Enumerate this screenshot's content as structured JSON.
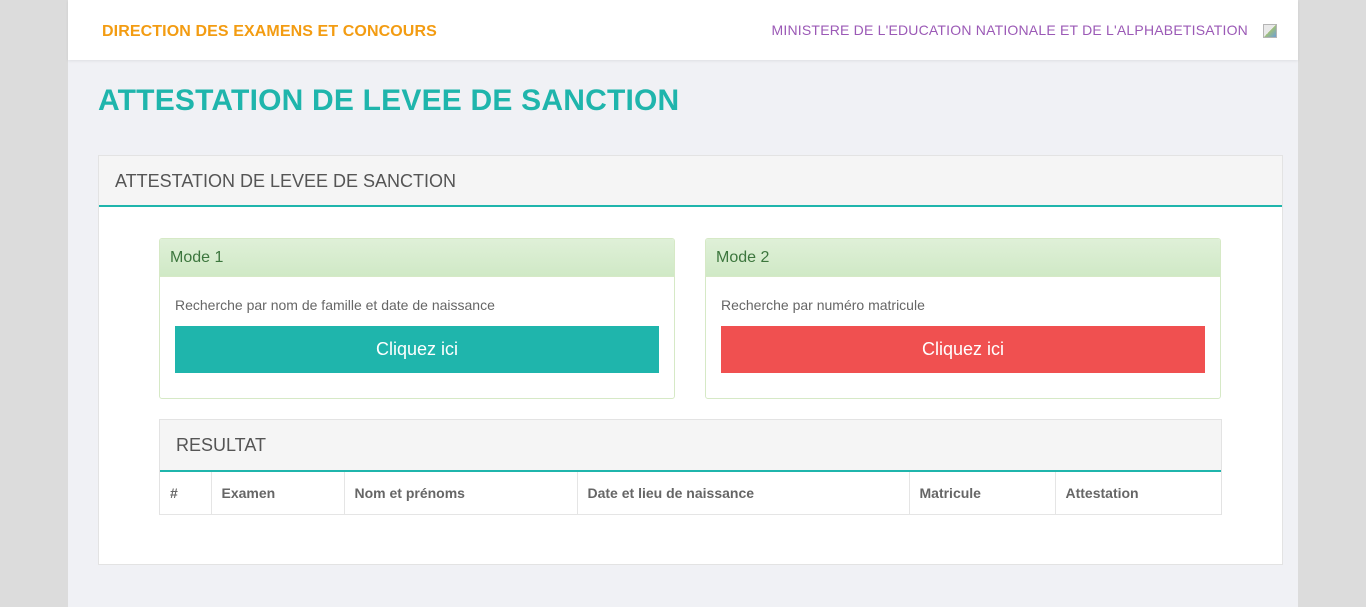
{
  "header": {
    "brand": "DIRECTION DES EXAMENS ET CONCOURS",
    "ministry": "MINISTERE DE L'EDUCATION NATIONALE ET DE L'ALPHABETISATION"
  },
  "page": {
    "title": "ATTESTATION DE LEVEE DE SANCTION"
  },
  "panel": {
    "heading": "ATTESTATION DE LEVEE DE SANCTION"
  },
  "modes": [
    {
      "heading": "Mode 1",
      "description": "Recherche par nom de famille et date de naissance",
      "button": "Cliquez ici",
      "button_color": "#1fb5ac"
    },
    {
      "heading": "Mode 2",
      "description": "Recherche par numéro matricule",
      "button": "Cliquez ici",
      "button_color": "#f05050"
    }
  ],
  "result": {
    "heading": "RESULTAT",
    "columns": [
      "#",
      "Examen",
      "Nom et prénoms",
      "Date et lieu de naissance",
      "Matricule",
      "Attestation"
    ]
  },
  "colors": {
    "accent": "#1fb5ac",
    "brand": "#f39c12",
    "ministry": "#9b59b6",
    "danger": "#f05050"
  }
}
